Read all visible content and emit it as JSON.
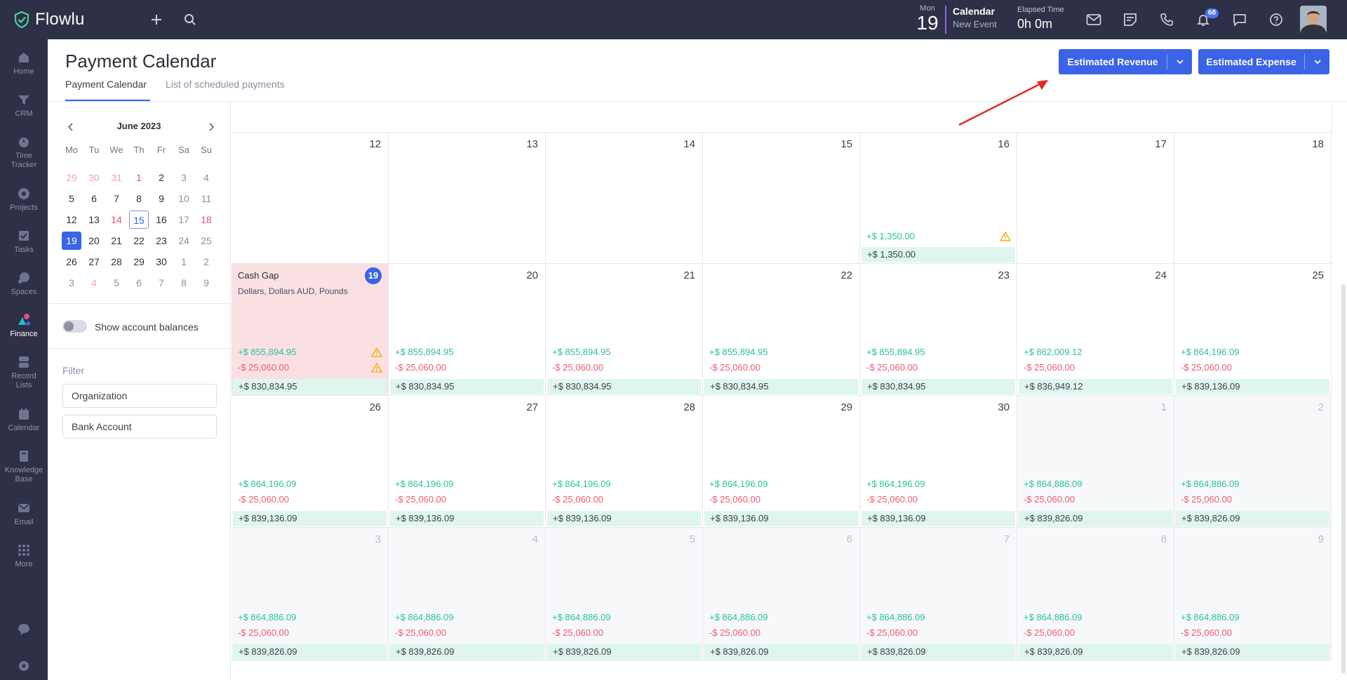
{
  "app": {
    "name": "Flowlu"
  },
  "topbar": {
    "date_dow": "Mon",
    "date_num": "19",
    "calendar_title": "Calendar",
    "calendar_sub": "New Event",
    "elapsed_label": "Elapsed Time",
    "elapsed_value": "0h 0m",
    "notification_count": "68",
    "icons": [
      "plus-icon",
      "search-icon",
      "mail-icon",
      "notes-icon",
      "phone-icon",
      "bell-icon",
      "chat-icon",
      "help-icon"
    ]
  },
  "sidebar": {
    "items": [
      {
        "label": "Home",
        "icon": "home-icon"
      },
      {
        "label": "CRM",
        "icon": "crm-icon"
      },
      {
        "label": "Time Tracker",
        "icon": "timer-icon"
      },
      {
        "label": "Projects",
        "icon": "projects-icon"
      },
      {
        "label": "Tasks",
        "icon": "tasks-icon"
      },
      {
        "label": "Spaces",
        "icon": "spaces-icon"
      },
      {
        "label": "Finance",
        "icon": "finance-icon",
        "active": true
      },
      {
        "label": "Record Lists",
        "icon": "record-lists-icon"
      },
      {
        "label": "Calendar",
        "icon": "calendar-icon"
      },
      {
        "label": "Knowledge Base",
        "icon": "knowledge-base-icon"
      },
      {
        "label": "Email",
        "icon": "email-icon"
      },
      {
        "label": "More",
        "icon": "more-icon"
      }
    ]
  },
  "page": {
    "title": "Payment Calendar",
    "tabs": [
      "Payment Calendar",
      "List of scheduled payments"
    ],
    "revenue_button": "Estimated Revenue",
    "expense_button": "Estimated Expense"
  },
  "mini_calendar": {
    "month": "June 2023",
    "dow": [
      "Mo",
      "Tu",
      "We",
      "Th",
      "Fr",
      "Sa",
      "Su"
    ],
    "weeks": [
      [
        "29",
        "30",
        "31",
        "1",
        "2",
        "3",
        "4"
      ],
      [
        "5",
        "6",
        "7",
        "8",
        "9",
        "10",
        "11"
      ],
      [
        "12",
        "13",
        "14",
        "15",
        "16",
        "17",
        "18"
      ],
      [
        "19",
        "20",
        "21",
        "22",
        "23",
        "24",
        "25"
      ],
      [
        "26",
        "27",
        "28",
        "29",
        "30",
        "1",
        "2"
      ],
      [
        "3",
        "4",
        "5",
        "6",
        "7",
        "8",
        "9"
      ]
    ]
  },
  "left_panel": {
    "toggle_label": "Show account balances",
    "filter_label": "Filter",
    "filter_organization": "Organization",
    "filter_bank_account": "Bank Account"
  },
  "calendar": {
    "weeks": [
      {
        "days": [
          {
            "num": "12"
          },
          {
            "num": "13"
          },
          {
            "num": "14"
          },
          {
            "num": "15"
          },
          {
            "num": "16",
            "income": "+$ 1,350.00",
            "balance": "+$ 1,350.00",
            "warn_income": true
          },
          {
            "num": "17"
          },
          {
            "num": "18"
          }
        ]
      },
      {
        "days": [
          {
            "num": "19",
            "today": true,
            "cash_gap": true,
            "cg_title": "Cash Gap",
            "cg_sub": "Dollars, Dollars AUD, Pounds",
            "income": "+$ 855,894.95",
            "expense": "-$ 25,060.00",
            "balance": "+$ 830,834.95",
            "warn_income": true,
            "warn_expense": true
          },
          {
            "num": "20",
            "income": "+$ 855,894.95",
            "expense": "-$ 25,060.00",
            "balance": "+$ 830,834.95"
          },
          {
            "num": "21",
            "income": "+$ 855,894.95",
            "expense": "-$ 25,060.00",
            "balance": "+$ 830,834.95"
          },
          {
            "num": "22",
            "income": "+$ 855,894.95",
            "expense": "-$ 25,060.00",
            "balance": "+$ 830,834.95"
          },
          {
            "num": "23",
            "income": "+$ 855,894.95",
            "expense": "-$ 25,060.00",
            "balance": "+$ 830,834.95"
          },
          {
            "num": "24",
            "income": "+$ 862,009.12",
            "expense": "-$ 25,060.00",
            "balance": "+$ 836,949.12"
          },
          {
            "num": "25",
            "income": "+$ 864,196.09",
            "expense": "-$ 25,060.00",
            "balance": "+$ 839,136.09"
          }
        ]
      },
      {
        "days": [
          {
            "num": "26",
            "income": "+$ 864,196.09",
            "expense": "-$ 25,060.00",
            "balance": "+$ 839,136.09"
          },
          {
            "num": "27",
            "income": "+$ 864,196.09",
            "expense": "-$ 25,060.00",
            "balance": "+$ 839,136.09"
          },
          {
            "num": "28",
            "income": "+$ 864,196.09",
            "expense": "-$ 25,060.00",
            "balance": "+$ 839,136.09"
          },
          {
            "num": "29",
            "income": "+$ 864,196.09",
            "expense": "-$ 25,060.00",
            "balance": "+$ 839,136.09"
          },
          {
            "num": "30",
            "income": "+$ 864,196.09",
            "expense": "-$ 25,060.00",
            "balance": "+$ 839,136.09"
          },
          {
            "num": "1",
            "out": true,
            "income": "+$ 864,886.09",
            "expense": "-$ 25,060.00",
            "balance": "+$ 839,826.09"
          },
          {
            "num": "2",
            "out": true,
            "income": "+$ 864,886.09",
            "expense": "-$ 25,060.00",
            "balance": "+$ 839,826.09"
          }
        ]
      },
      {
        "days": [
          {
            "num": "3",
            "out": true,
            "income": "+$ 864,886.09",
            "expense": "-$ 25,060.00",
            "balance": "+$ 839,826.09"
          },
          {
            "num": "4",
            "out": true,
            "income": "+$ 864,886.09",
            "expense": "-$ 25,060.00",
            "balance": "+$ 839,826.09"
          },
          {
            "num": "5",
            "out": true,
            "income": "+$ 864,886.09",
            "expense": "-$ 25,060.00",
            "balance": "+$ 839,826.09"
          },
          {
            "num": "6",
            "out": true,
            "income": "+$ 864,886.09",
            "expense": "-$ 25,060.00",
            "balance": "+$ 839,826.09"
          },
          {
            "num": "7",
            "out": true,
            "income": "+$ 864,886.09",
            "expense": "-$ 25,060.00",
            "balance": "+$ 839,826.09"
          },
          {
            "num": "8",
            "out": true,
            "income": "+$ 864,886.09",
            "expense": "-$ 25,060.00",
            "balance": "+$ 839,826.09"
          },
          {
            "num": "9",
            "out": true,
            "income": "+$ 864,886.09",
            "expense": "-$ 25,060.00",
            "balance": "+$ 839,826.09"
          }
        ]
      }
    ]
  },
  "colors": {
    "topbar_bg": "#2d3046",
    "accent_blue": "#3a63e6",
    "income_green": "#2bc19a",
    "expense_red": "#ef5b70",
    "balance_bg": "#dff6ef",
    "cash_gap_bg": "#fbe0e3",
    "annotation_arrow": "#e8261f"
  }
}
